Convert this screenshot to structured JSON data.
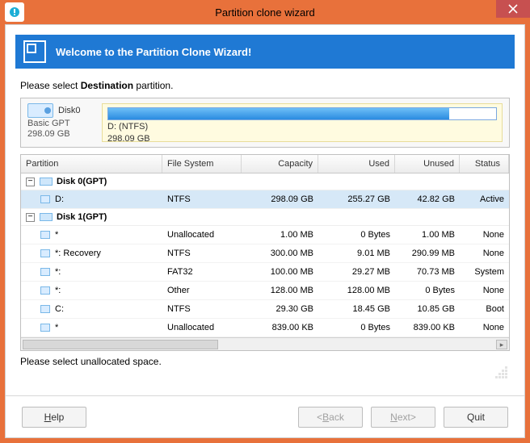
{
  "titlebar": {
    "title": "Partition clone wizard"
  },
  "banner": {
    "text": "Welcome to the Partition Clone Wizard!"
  },
  "instruction_pre": "Please select ",
  "instruction_bold": "Destination",
  "instruction_post": " partition.",
  "sourceDisk": {
    "name": "Disk0",
    "type": "Basic GPT",
    "size": "298.09 GB",
    "part_label": "D: (NTFS)",
    "part_size": "298.09 GB"
  },
  "columns": {
    "partition": "Partition",
    "fs": "File System",
    "capacity": "Capacity",
    "used": "Used",
    "unused": "Unused",
    "status": "Status"
  },
  "groups": [
    {
      "title": "Disk 0(GPT)",
      "rows": [
        {
          "name": "D:",
          "fs": "NTFS",
          "cap": "298.09 GB",
          "used": "255.27 GB",
          "unused": "42.82 GB",
          "status": "Active",
          "selected": true
        }
      ]
    },
    {
      "title": "Disk 1(GPT)",
      "rows": [
        {
          "name": "*",
          "fs": "Unallocated",
          "cap": "1.00 MB",
          "used": "0 Bytes",
          "unused": "1.00 MB",
          "status": "None"
        },
        {
          "name": "*: Recovery",
          "fs": "NTFS",
          "cap": "300.00 MB",
          "used": "9.01 MB",
          "unused": "290.99 MB",
          "status": "None"
        },
        {
          "name": "*:",
          "fs": "FAT32",
          "cap": "100.00 MB",
          "used": "29.27 MB",
          "unused": "70.73 MB",
          "status": "System"
        },
        {
          "name": "*:",
          "fs": "Other",
          "cap": "128.00 MB",
          "used": "128.00 MB",
          "unused": "0 Bytes",
          "status": "None"
        },
        {
          "name": "C:",
          "fs": "NTFS",
          "cap": "29.30 GB",
          "used": "18.45 GB",
          "unused": "10.85 GB",
          "status": "Boot"
        },
        {
          "name": "*",
          "fs": "Unallocated",
          "cap": "839.00 KB",
          "used": "0 Bytes",
          "unused": "839.00 KB",
          "status": "None"
        }
      ]
    }
  ],
  "hint": "Please select unallocated space.",
  "buttons": {
    "help_u": "H",
    "help_rest": "elp",
    "back_lt": "<",
    "back_u": "B",
    "back_rest": "ack",
    "next_u": "N",
    "next_rest": "ext>",
    "quit": "Quit"
  }
}
